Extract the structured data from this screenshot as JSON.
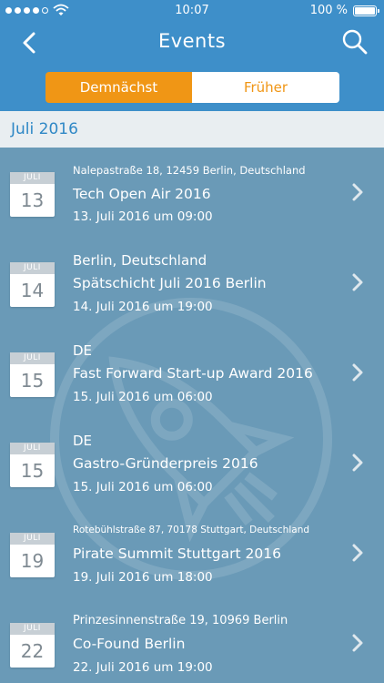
{
  "status_bar": {
    "time": "10:07",
    "battery": "100 %",
    "signal_icon": "signal-dots-icon",
    "wifi_icon": "wifi-icon",
    "battery_icon": "battery-icon"
  },
  "nav": {
    "title": "Events",
    "back_icon": "chevron-left-icon",
    "search_icon": "search-icon"
  },
  "segments": {
    "active": "Demnächst",
    "inactive": "Früher"
  },
  "section": {
    "title": "Juli 2016"
  },
  "colors": {
    "bar": "#3e8fc9",
    "accent": "#f09615",
    "list_background": "#6a9ab7",
    "section_text": "#2f88c6"
  },
  "events": [
    {
      "month": "JULI",
      "day": "13",
      "location": "Nalepastraße 18, 12459 Berlin, Deutschland",
      "name": "Tech Open Air 2016",
      "date": "13. Juli 2016 um 09:00"
    },
    {
      "month": "JULI",
      "day": "14",
      "location": "Berlin, Deutschland",
      "name": "Spätschicht Juli 2016 Berlin",
      "date": "14. Juli 2016 um 19:00"
    },
    {
      "month": "JULI",
      "day": "15",
      "location": "DE",
      "name": "Fast Forward Start-up Award 2016",
      "date": "15. Juli 2016 um 06:00"
    },
    {
      "month": "JULI",
      "day": "15",
      "location": "DE",
      "name": "Gastro-Gründerpreis 2016",
      "date": "15. Juli 2016 um 06:00"
    },
    {
      "month": "JULI",
      "day": "19",
      "location": "Rotebühlstraße 87, 70178 Stuttgart, Deutschland",
      "name": "Pirate Summit Stuttgart 2016",
      "date": "19. Juli 2016 um 18:00"
    },
    {
      "month": "JULI",
      "day": "22",
      "location": "Prinzesinnenstraße 19, 10969 Berlin",
      "name": "Co-Found Berlin",
      "date": "22. Juli 2016 um 19:00"
    }
  ]
}
